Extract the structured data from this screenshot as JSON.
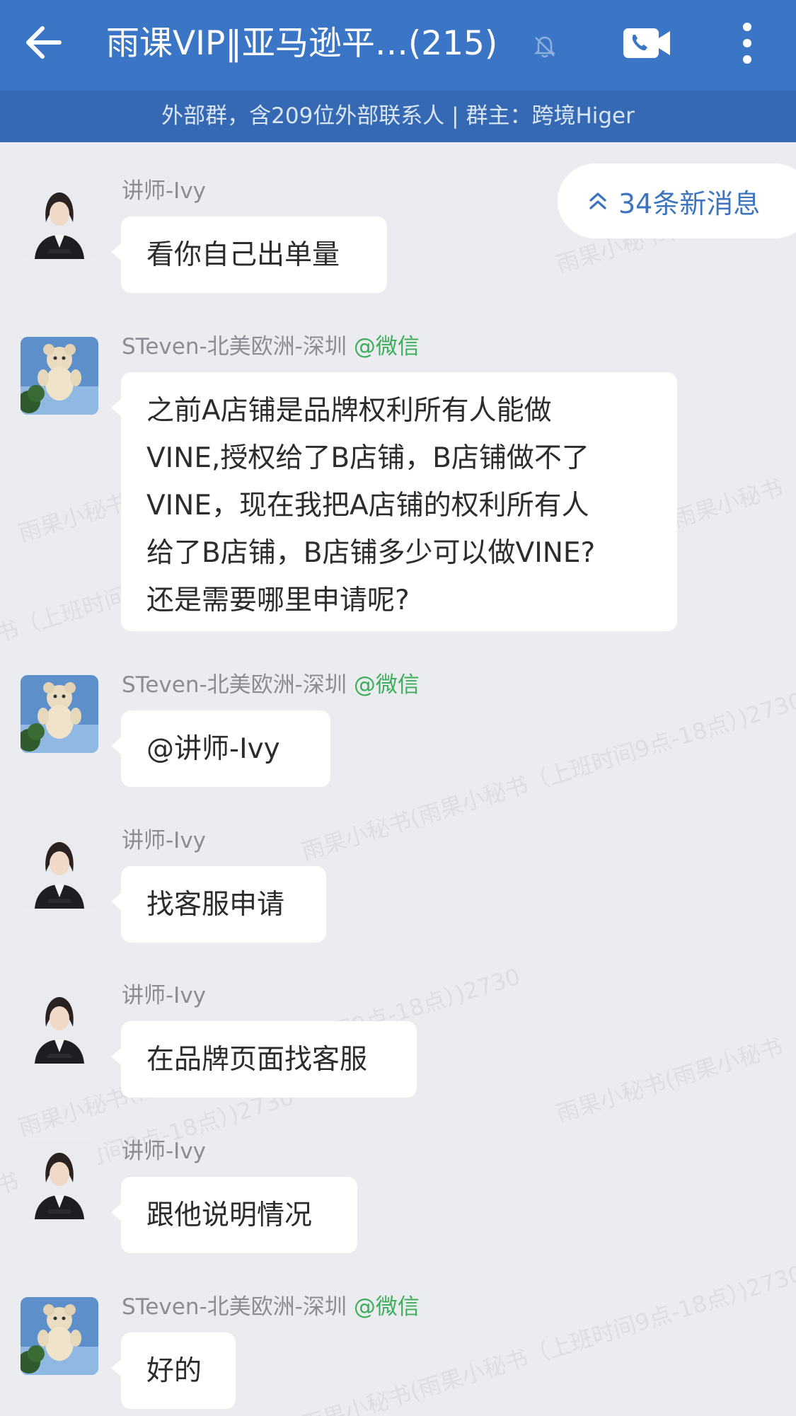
{
  "header": {
    "title": "雨课VIP‖亚马逊平…(215)",
    "subtitle": "外部群，含209位外部联系人 | 群主：跨境Higer"
  },
  "new_messages": {
    "label": "34条新消息"
  },
  "watermark_text": "雨果小秘书(雨果小秘书（上班时间9点-18点）)2730",
  "messages": [
    {
      "sender": "讲师-Ivy",
      "tag": "",
      "text": "看你自己出单量"
    },
    {
      "sender": "STeven-北美欧洲-深圳",
      "tag": "@微信",
      "lines": [
        "之前A店铺是品牌权利所有人能做",
        "VINE,授权给了B店铺，B店铺做不了",
        "VINE，现在我把A店铺的权利所有人",
        "给了B店铺，B店铺多少可以做VINE?",
        "还是需要哪里申请呢?"
      ]
    },
    {
      "sender": "STeven-北美欧洲-深圳",
      "tag": "@微信",
      "text": "@讲师-Ivy"
    },
    {
      "sender": "讲师-Ivy",
      "tag": "",
      "text": "找客服申请"
    },
    {
      "sender": "讲师-Ivy",
      "tag": "",
      "text": "在品牌页面找客服"
    },
    {
      "sender": "讲师-Ivy",
      "tag": "",
      "text": "跟他说明情况"
    },
    {
      "sender": "STeven-北美欧洲-深圳",
      "tag": "@微信",
      "text": "好的"
    }
  ],
  "colors": {
    "header_bg": "#3b76c6",
    "subheader_bg": "#3569b3",
    "chat_bg": "#ebecef",
    "link_blue": "#3d74c0",
    "wechat_green": "#3dae5a"
  }
}
